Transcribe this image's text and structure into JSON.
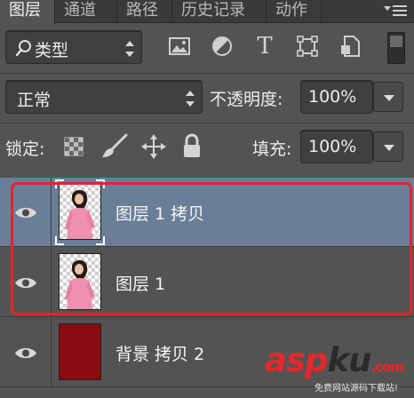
{
  "tabs": [
    {
      "label": "图层",
      "active": true
    },
    {
      "label": "通道",
      "active": false
    },
    {
      "label": "路径",
      "active": false
    },
    {
      "label": "历史记录",
      "active": false
    },
    {
      "label": "动作",
      "active": false
    }
  ],
  "filter": {
    "kind_label": "类型",
    "kind_icon": "search-icon",
    "icons": [
      "image-filter-icon",
      "adjustment-filter-icon",
      "type-filter-icon",
      "shape-filter-icon",
      "smart-object-filter-icon"
    ],
    "type_glyph": "T"
  },
  "blend": {
    "mode": "正常",
    "opacity_label": "不透明度:",
    "opacity_value": "100%"
  },
  "lock": {
    "label": "锁定:",
    "icons": [
      "lock-transparent-pixels-icon",
      "lock-image-pixels-icon",
      "lock-position-icon",
      "lock-all-icon"
    ],
    "fill_label": "填充:",
    "fill_value": "100%"
  },
  "layers": [
    {
      "name": "图层 1 拷贝",
      "visible": true,
      "selected": true,
      "thumbnail": "woman-pink-dress-transparent"
    },
    {
      "name": "图层 1",
      "visible": true,
      "selected": false,
      "thumbnail": "woman-pink-dress-transparent"
    },
    {
      "name": "背景 拷贝 2",
      "visible": true,
      "selected": false,
      "thumbnail": "solid-dark-red",
      "thumb_color": "#8a0a10"
    }
  ],
  "colors": {
    "panel_bg": "#535353",
    "selected_row": "#6a7e98",
    "highlight": "#e0262c"
  },
  "watermark": {
    "part1": "asp",
    "part2": "ku",
    "part3": ".com",
    "subtitle": "免费网站源码下载站!"
  }
}
